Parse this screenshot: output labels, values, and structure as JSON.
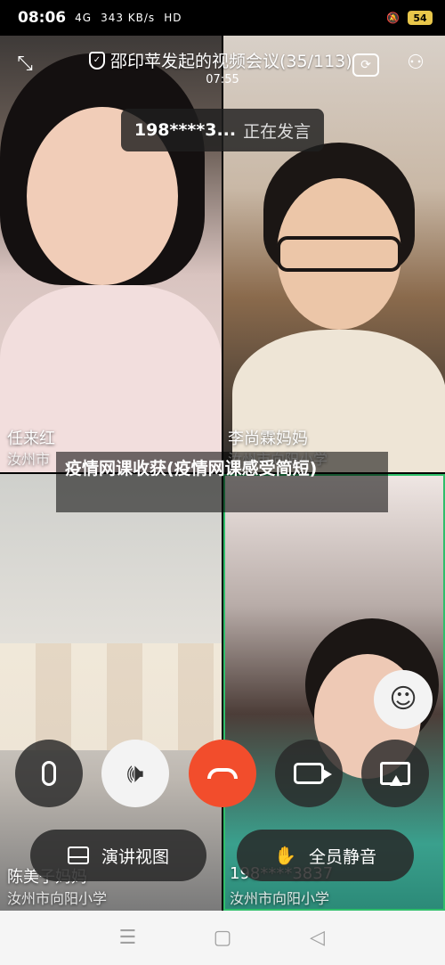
{
  "status_bar": {
    "time": "08:06",
    "signal": "4G",
    "network_speed": "343 KB/s",
    "hd_label": "HD",
    "battery": "54"
  },
  "meeting": {
    "title": "邵印苹发起的视频会议(35/113)",
    "timer": "07:55"
  },
  "speaking_banner": {
    "number": "198****3...",
    "status": "正在发言"
  },
  "participants": [
    {
      "name": "任来红",
      "school": "汝州市"
    },
    {
      "name": "李尚霖妈妈",
      "school": "汝州市向阳小学"
    },
    {
      "name": "陈美子妈妈",
      "school": "汝州市向阳小学"
    },
    {
      "name": "198****3837",
      "school": "汝州市向阳小学"
    }
  ],
  "article_title": "疫情网课收获(疫情网课感受简短)",
  "controls": {
    "speech_view_label": "演讲视图",
    "mute_all_label": "全员静音"
  },
  "icons": {
    "exit_fullscreen": "exit-fullscreen-icon",
    "shield": "shield-icon",
    "camera_switch": "camera-switch-icon",
    "members": "members-icon",
    "microphone": "microphone-icon",
    "speaker": "speaker-icon",
    "hang_up": "hang-up-icon",
    "video": "video-camera-icon",
    "screen_share": "screen-share-icon",
    "beauty": "beauty-filter-icon",
    "layout": "layout-icon",
    "mute_all": "mute-all-icon"
  },
  "colors": {
    "hang_up": "#f24d2c",
    "active_speaker_border": "#2fbf6a",
    "battery": "#e8c64a"
  }
}
